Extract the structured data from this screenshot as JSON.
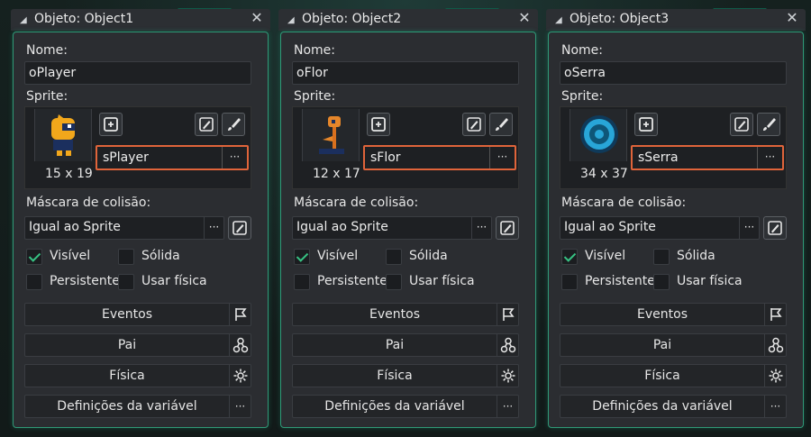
{
  "panels": [
    {
      "title": "Objeto: Object1",
      "name_label": "Nome:",
      "name_value": "oPlayer",
      "sprite_label": "Sprite:",
      "sprite_name": "sPlayer",
      "sprite_dims": "15 x 19",
      "mask_label": "Máscara de colisão:",
      "mask_value": "Igual ao Sprite",
      "visible_label": "Visível",
      "solid_label": "Sólida",
      "persistent_label": "Persistente",
      "physics_use_label": "Usar física",
      "visible_checked": true,
      "solid_checked": false,
      "persistent_checked": false,
      "physics_checked": false,
      "events_label": "Eventos",
      "parent_label": "Pai",
      "physics_label": "Física",
      "vars_label": "Definições da variável",
      "dots": "···",
      "close": "✕"
    },
    {
      "title": "Objeto: Object2",
      "name_label": "Nome:",
      "name_value": "oFlor",
      "sprite_label": "Sprite:",
      "sprite_name": "sFlor",
      "sprite_dims": "12 x 17",
      "mask_label": "Máscara de colisão:",
      "mask_value": "Igual ao Sprite",
      "visible_label": "Visível",
      "solid_label": "Sólida",
      "persistent_label": "Persistente",
      "physics_use_label": "Usar física",
      "visible_checked": true,
      "solid_checked": false,
      "persistent_checked": false,
      "physics_checked": false,
      "events_label": "Eventos",
      "parent_label": "Pai",
      "physics_label": "Física",
      "vars_label": "Definições da variável",
      "dots": "···",
      "close": "✕"
    },
    {
      "title": "Objeto: Object3",
      "name_label": "Nome:",
      "name_value": "oSerra",
      "sprite_label": "Sprite:",
      "sprite_name": "sSerra",
      "sprite_dims": "34 x 37",
      "mask_label": "Máscara de colisão:",
      "mask_value": "Igual ao Sprite",
      "visible_label": "Visível",
      "solid_label": "Sólida",
      "persistent_label": "Persistente",
      "physics_use_label": "Usar física",
      "visible_checked": true,
      "solid_checked": false,
      "persistent_checked": false,
      "physics_checked": false,
      "events_label": "Eventos",
      "parent_label": "Pai",
      "physics_label": "Física",
      "vars_label": "Definições da variável",
      "dots": "···",
      "close": "✕"
    }
  ],
  "colors": {
    "accent_border": "#2f9977",
    "sprite_highlight": "#e0643a",
    "check": "#37c283"
  }
}
